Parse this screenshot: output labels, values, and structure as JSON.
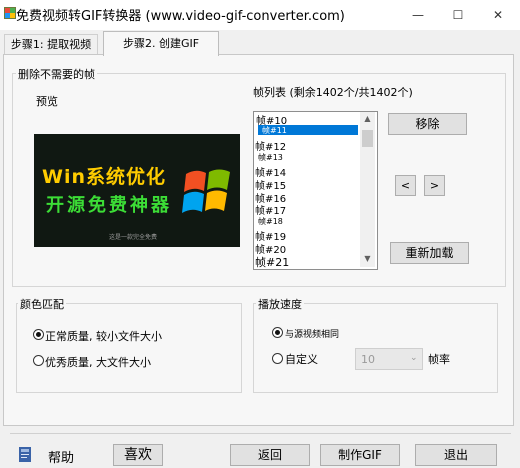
{
  "window": {
    "title": "免费视频转GIF转换器 (www.video-gif-converter.com)",
    "minimize_glyph": "—",
    "maximize_glyph": "☐",
    "close_glyph": "✕"
  },
  "tabs": [
    {
      "label": "步骤1: 提取视频",
      "active": false
    },
    {
      "label": "步骤2. 创建GIF",
      "active": true
    }
  ],
  "remove_frames": {
    "group_label": "删除不需要的帧",
    "preview_label": "预览",
    "preview_line1": "Win系统优化",
    "preview_line2": "开源免费神器",
    "preview_caption": "这是一款完全免费",
    "list_label": "帧列表 (剩余1402个/共1402个)",
    "frames": [
      "帧#10",
      "帧#11",
      "帧#12",
      "帧#13",
      "帧#14",
      "帧#15",
      "帧#16",
      "帧#17",
      "帧#18",
      "帧#19",
      "帧#20",
      "帧#21"
    ],
    "selected_frame": "帧#11",
    "remove_button": "移除",
    "prev_button": "<",
    "next_button": ">",
    "reload_button": "重新加载"
  },
  "color_match": {
    "group_label": "颜色匹配",
    "options": [
      {
        "label": "正常质量, 较小文件大小",
        "selected": true
      },
      {
        "label": "优秀质量, 大文件大小",
        "selected": false
      }
    ]
  },
  "speed": {
    "group_label": "播放速度",
    "option_same": "与源视频相同",
    "option_custom": "自定义",
    "same_selected": true,
    "fps_value": "10",
    "fps_label": "帧率"
  },
  "footer": {
    "help": "帮助",
    "like": "喜欢",
    "back": "返回",
    "make_gif": "制作GIF",
    "exit": "退出"
  },
  "colors": {
    "selection": "#0078d7",
    "preview_bg": "#101812",
    "preview_yellow": "#ffcc00",
    "preview_green": "#3cdd36"
  }
}
